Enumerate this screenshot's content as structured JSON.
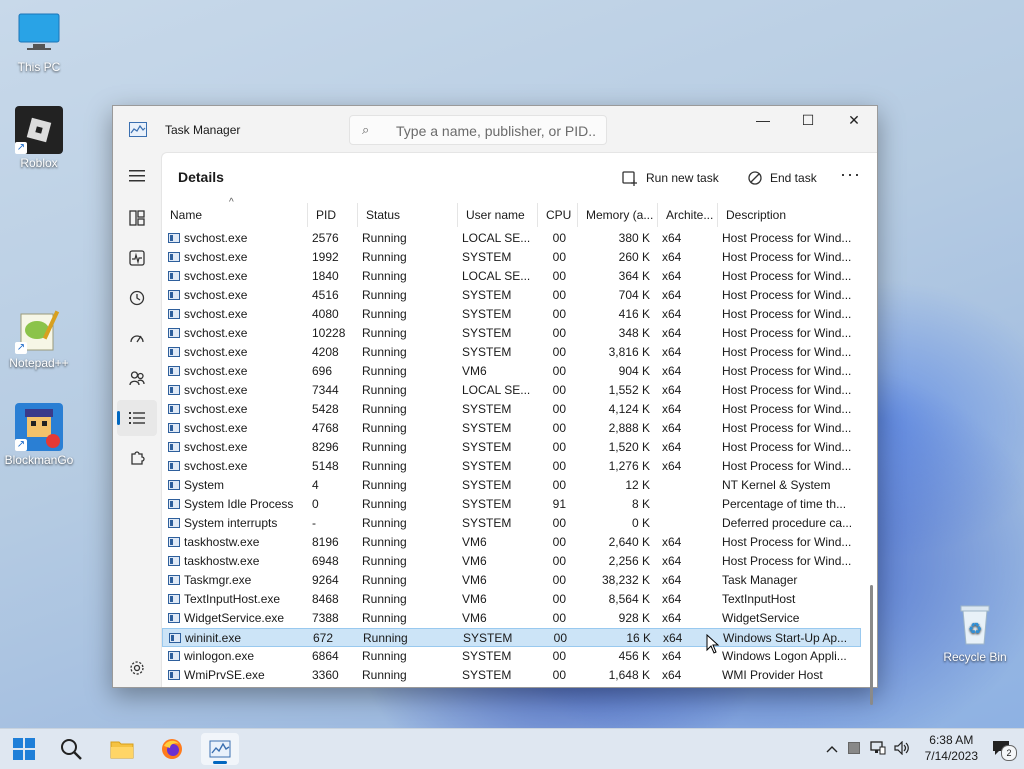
{
  "desktop": {
    "icons": [
      {
        "label": "This PC"
      },
      {
        "label": "Roblox"
      },
      {
        "label": "Notepad++"
      },
      {
        "label": "BlockmanGo"
      },
      {
        "label": "Recycle Bin"
      }
    ]
  },
  "window": {
    "title": "Task Manager",
    "search_placeholder": "Type a name, publisher, or PID...",
    "controls": {
      "minimize": "—",
      "maximize": "☐",
      "close": "✕"
    }
  },
  "page": {
    "title": "Details",
    "run_new_task": "Run new task",
    "end_task": "End task",
    "more": "···"
  },
  "columns": [
    "Name",
    "PID",
    "Status",
    "User name",
    "CPU",
    "Memory (a...",
    "Archite...",
    "Description"
  ],
  "rows": [
    [
      "svchost.exe",
      "2576",
      "Running",
      "LOCAL SE...",
      "00",
      "380 K",
      "x64",
      "Host Process for Wind..."
    ],
    [
      "svchost.exe",
      "1992",
      "Running",
      "SYSTEM",
      "00",
      "260 K",
      "x64",
      "Host Process for Wind..."
    ],
    [
      "svchost.exe",
      "1840",
      "Running",
      "LOCAL SE...",
      "00",
      "364 K",
      "x64",
      "Host Process for Wind..."
    ],
    [
      "svchost.exe",
      "4516",
      "Running",
      "SYSTEM",
      "00",
      "704 K",
      "x64",
      "Host Process for Wind..."
    ],
    [
      "svchost.exe",
      "4080",
      "Running",
      "SYSTEM",
      "00",
      "416 K",
      "x64",
      "Host Process for Wind..."
    ],
    [
      "svchost.exe",
      "10228",
      "Running",
      "SYSTEM",
      "00",
      "348 K",
      "x64",
      "Host Process for Wind..."
    ],
    [
      "svchost.exe",
      "4208",
      "Running",
      "SYSTEM",
      "00",
      "3,816 K",
      "x64",
      "Host Process for Wind..."
    ],
    [
      "svchost.exe",
      "696",
      "Running",
      "VM6",
      "00",
      "904 K",
      "x64",
      "Host Process for Wind..."
    ],
    [
      "svchost.exe",
      "7344",
      "Running",
      "LOCAL SE...",
      "00",
      "1,552 K",
      "x64",
      "Host Process for Wind..."
    ],
    [
      "svchost.exe",
      "5428",
      "Running",
      "SYSTEM",
      "00",
      "4,124 K",
      "x64",
      "Host Process for Wind..."
    ],
    [
      "svchost.exe",
      "4768",
      "Running",
      "SYSTEM",
      "00",
      "2,888 K",
      "x64",
      "Host Process for Wind..."
    ],
    [
      "svchost.exe",
      "8296",
      "Running",
      "SYSTEM",
      "00",
      "1,520 K",
      "x64",
      "Host Process for Wind..."
    ],
    [
      "svchost.exe",
      "5148",
      "Running",
      "SYSTEM",
      "00",
      "1,276 K",
      "x64",
      "Host Process for Wind..."
    ],
    [
      "System",
      "4",
      "Running",
      "SYSTEM",
      "00",
      "12 K",
      "",
      "NT Kernel & System"
    ],
    [
      "System Idle Process",
      "0",
      "Running",
      "SYSTEM",
      "91",
      "8 K",
      "",
      "Percentage of time th..."
    ],
    [
      "System interrupts",
      "-",
      "Running",
      "SYSTEM",
      "00",
      "0 K",
      "",
      "Deferred procedure ca..."
    ],
    [
      "taskhostw.exe",
      "8196",
      "Running",
      "VM6",
      "00",
      "2,640 K",
      "x64",
      "Host Process for Wind..."
    ],
    [
      "taskhostw.exe",
      "6948",
      "Running",
      "VM6",
      "00",
      "2,256 K",
      "x64",
      "Host Process for Wind..."
    ],
    [
      "Taskmgr.exe",
      "9264",
      "Running",
      "VM6",
      "00",
      "38,232 K",
      "x64",
      "Task Manager"
    ],
    [
      "TextInputHost.exe",
      "8468",
      "Running",
      "VM6",
      "00",
      "8,564 K",
      "x64",
      "TextInputHost"
    ],
    [
      "WidgetService.exe",
      "7388",
      "Running",
      "VM6",
      "00",
      "928 K",
      "x64",
      "WidgetService"
    ],
    [
      "wininit.exe",
      "672",
      "Running",
      "SYSTEM",
      "00",
      "16 K",
      "x64",
      "Windows Start-Up Ap..."
    ],
    [
      "winlogon.exe",
      "6864",
      "Running",
      "SYSTEM",
      "00",
      "456 K",
      "x64",
      "Windows Logon Appli..."
    ],
    [
      "WmiPrvSE.exe",
      "3360",
      "Running",
      "SYSTEM",
      "00",
      "1,648 K",
      "x64",
      "WMI Provider Host"
    ]
  ],
  "selected_row": 21,
  "taskbar": {
    "time": "6:38 AM",
    "date": "7/14/2023",
    "notification_count": "2"
  },
  "colors": {
    "accent": "#0067c0",
    "selection": "#cce4f7"
  }
}
